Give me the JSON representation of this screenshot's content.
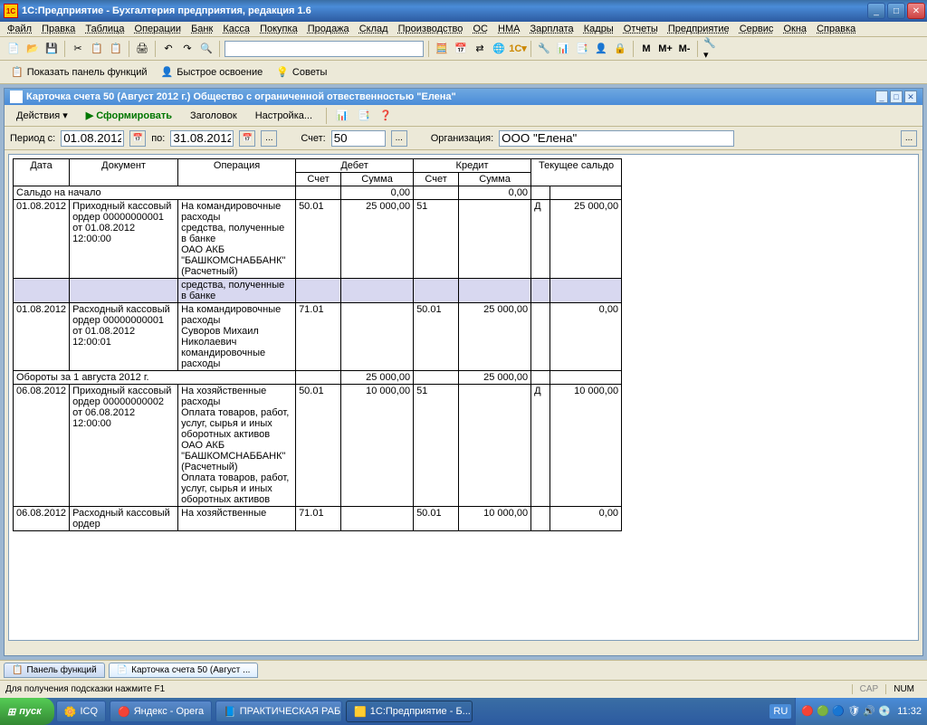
{
  "titlebar": {
    "text": "1С:Предприятие - Бухгалтерия предприятия, редакция 1.6"
  },
  "menu": [
    "Файл",
    "Правка",
    "Таблица",
    "Операции",
    "Банк",
    "Касса",
    "Покупка",
    "Продажа",
    "Склад",
    "Производство",
    "ОС",
    "НМА",
    "Зарплата",
    "Кадры",
    "Отчеты",
    "Предприятие",
    "Сервис",
    "Окна",
    "Справка"
  ],
  "toolbar2": {
    "panel": "Показать панель функций",
    "quick": "Быстрое освоение",
    "tips": "Советы"
  },
  "toolbar3_letters": [
    "M",
    "M+",
    "M-"
  ],
  "mdi": {
    "title": "Карточка счета 50 (Август 2012 г.) Общество с ограниченной отвественностью \"Елена\"",
    "actions_label": "Действия",
    "form_btn": "Сформировать",
    "header_btn": "Заголовок",
    "settings_btn": "Настройка..."
  },
  "params": {
    "period_label": "Период с:",
    "from": "01.08.2012",
    "to_label": "по:",
    "to": "31.08.2012",
    "account_label": "Счет:",
    "account": "50",
    "org_label": "Организация:",
    "org": "ООО \"Елена\""
  },
  "headers": {
    "date": "Дата",
    "doc": "Документ",
    "op": "Операция",
    "debit": "Дебет",
    "credit": "Кредит",
    "balance": "Текущее сальдо",
    "acct": "Счет",
    "sum": "Сумма"
  },
  "opening": {
    "label": "Сальдо на начало",
    "d": "0,00",
    "c": "0,00"
  },
  "rows": [
    {
      "date": "01.08.2012",
      "doc": "Приходный кассовый ордер 00000000001 от 01.08.2012 12:00:00",
      "op": "На командировочные расходы\nсредства, полученные в банке\nОАО АКБ \"БАШКОМСНАББАНК\" (Расчетный)",
      "d_acct": "50.01",
      "d_sum": "25 000,00",
      "c_acct": "51",
      "c_sum": "",
      "bal_d": "Д",
      "bal": "25 000,00",
      "highlight": "средства, полученные в банке"
    },
    {
      "date": "01.08.2012",
      "doc": "Расходный кассовый ордер 00000000001 от 01.08.2012 12:00:01",
      "op": "На командировочные расходы\nСуворов Михаил Николаевич командировочные расходы",
      "d_acct": "71.01",
      "d_sum": "",
      "c_acct": "50.01",
      "c_sum": "25 000,00",
      "bal_d": "",
      "bal": "0,00"
    }
  ],
  "turnover_day": {
    "label": "Обороты за 1 августа 2012 г.",
    "d": "25 000,00",
    "c": "25 000,00"
  },
  "rows2": [
    {
      "date": "06.08.2012",
      "doc": "Приходный кассовый ордер 00000000002 от 06.08.2012 12:00:00",
      "op": "На хозяйственные расходы\nОплата товаров, работ, услуг, сырья и иных оборотных активов\nОАО АКБ \"БАШКОМСНАББАНК\" (Расчетный)\nОплата товаров, работ, услуг, сырья и иных оборотных активов",
      "d_acct": "50.01",
      "d_sum": "10 000,00",
      "c_acct": "51",
      "c_sum": "",
      "bal_d": "Д",
      "bal": "10 000,00"
    },
    {
      "date": "06.08.2012",
      "doc": "Расходный кассовый ордер",
      "op": "На хозяйственные",
      "d_acct": "71.01",
      "d_sum": "",
      "c_acct": "50.01",
      "c_sum": "10 000,00",
      "bal_d": "",
      "bal": "0,00"
    }
  ],
  "tabs": {
    "panel": "Панель функций",
    "card": "Карточка счета 50 (Август ..."
  },
  "status": {
    "hint": "Для получения подсказки нажмите F1",
    "cap": "CAP",
    "num": "NUM"
  },
  "taskbar": {
    "start": "пуск",
    "items": [
      "ICQ",
      "Яндекс - Opera",
      "ПРАКТИЧЕСКАЯ РАБ...",
      "1С:Предприятие - Б..."
    ],
    "lang": "RU",
    "clock": "11:32"
  }
}
